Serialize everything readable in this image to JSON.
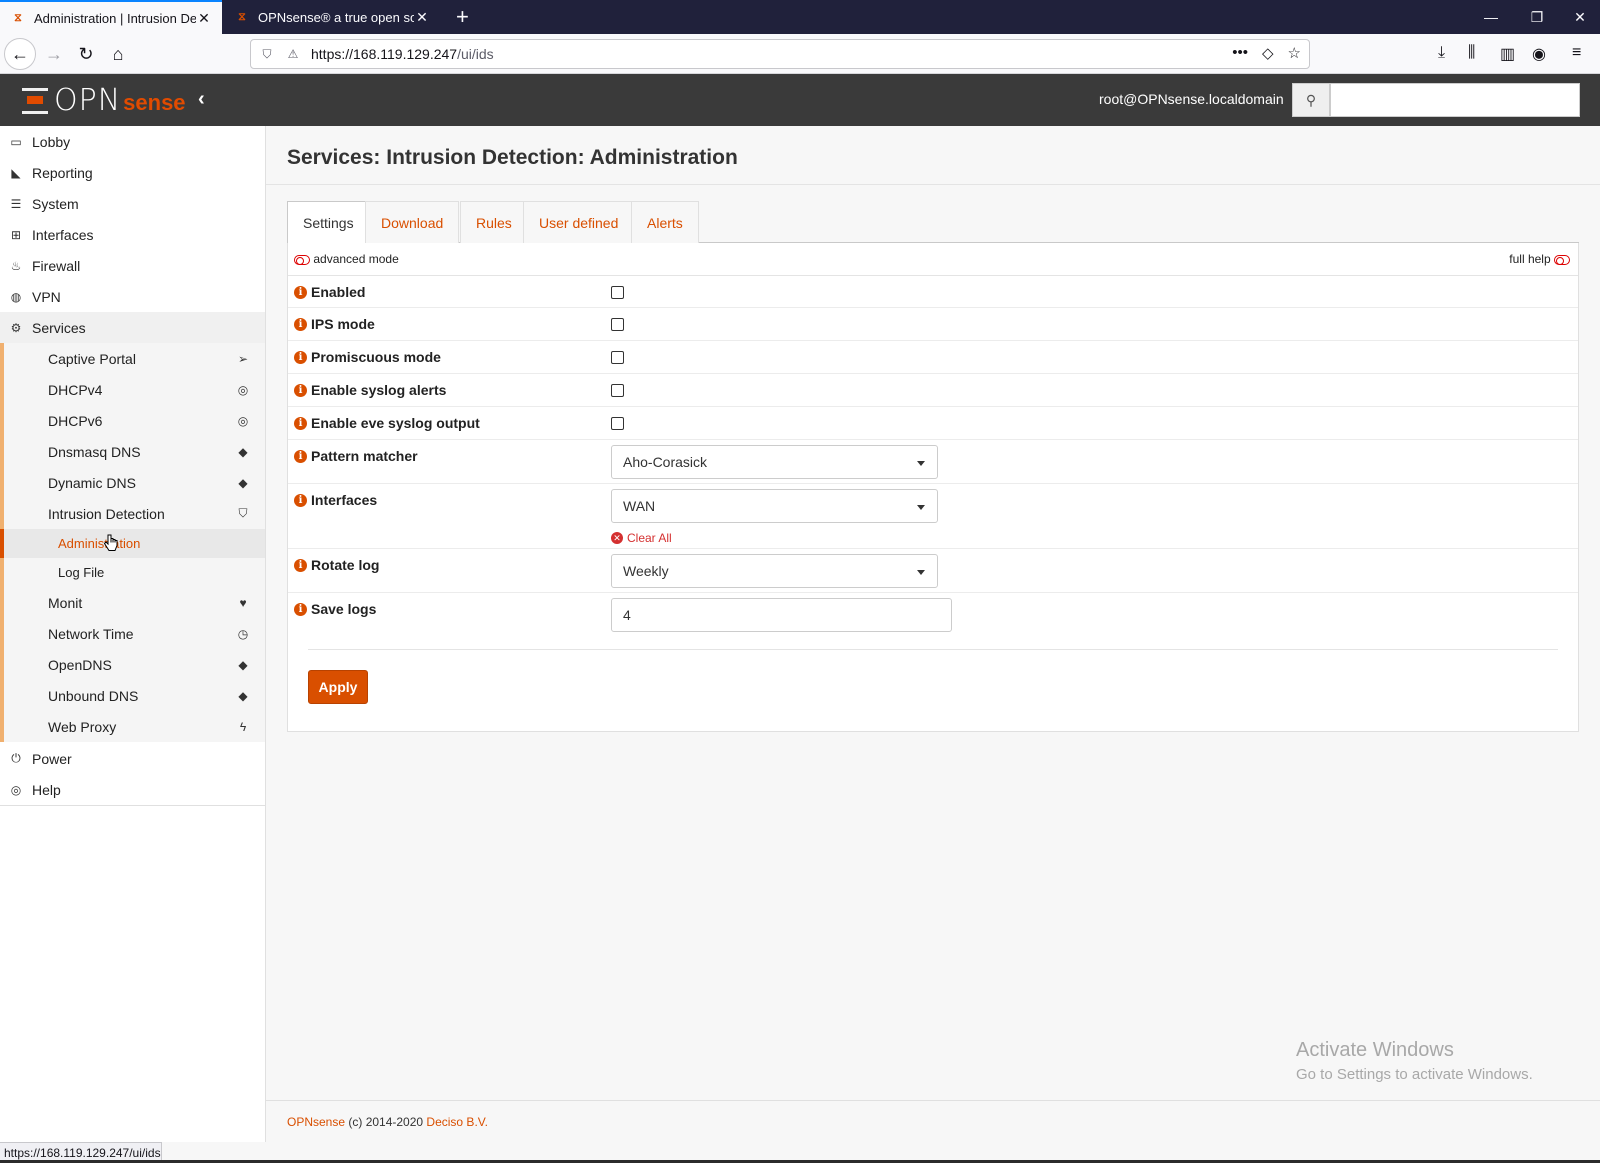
{
  "browser": {
    "tabs": [
      {
        "title": "Administration | Intrusion Dete"
      },
      {
        "title": "OPNsense® a true open sourc"
      }
    ],
    "url_host": "https://168.119.129.247",
    "url_path": "/ui/ids",
    "status_url": "https://168.119.129.247/ui/ids"
  },
  "header": {
    "logo_opn": "OPN",
    "logo_sense": "sense",
    "user": "root@OPNsense.localdomain",
    "search_placeholder": ""
  },
  "sidebar": {
    "items": [
      {
        "label": "Lobby",
        "icon": "laptop-icon"
      },
      {
        "label": "Reporting",
        "icon": "area-chart-icon"
      },
      {
        "label": "System",
        "icon": "server-icon"
      },
      {
        "label": "Interfaces",
        "icon": "sitemap-icon"
      },
      {
        "label": "Firewall",
        "icon": "fire-icon"
      },
      {
        "label": "VPN",
        "icon": "globe-icon"
      },
      {
        "label": "Services",
        "icon": "cog-icon"
      }
    ],
    "services": [
      {
        "label": "Captive Portal",
        "icon": "paper-plane-icon"
      },
      {
        "label": "DHCPv4",
        "icon": "bullseye-icon"
      },
      {
        "label": "DHCPv6",
        "icon": "bullseye-icon"
      },
      {
        "label": "Dnsmasq DNS",
        "icon": "tags-icon"
      },
      {
        "label": "Dynamic DNS",
        "icon": "tags-icon"
      },
      {
        "label": "Intrusion Detection",
        "icon": "shield-icon"
      },
      {
        "label": "Administration",
        "icon": ""
      },
      {
        "label": "Log File",
        "icon": ""
      },
      {
        "label": "Monit",
        "icon": "heartbeat-icon"
      },
      {
        "label": "Network Time",
        "icon": "clock-icon"
      },
      {
        "label": "OpenDNS",
        "icon": "tags-icon"
      },
      {
        "label": "Unbound DNS",
        "icon": "tags-icon"
      },
      {
        "label": "Web Proxy",
        "icon": "bolt-icon"
      }
    ],
    "bottom": [
      {
        "label": "Power",
        "icon": "plug-icon"
      },
      {
        "label": "Help",
        "icon": "life-ring-icon"
      }
    ]
  },
  "page": {
    "title": "Services: Intrusion Detection: Administration",
    "tabs": [
      "Settings",
      "Download",
      "Rules",
      "User defined",
      "Alerts"
    ],
    "advanced_mode": "advanced mode",
    "full_help": "full help",
    "fields": {
      "enabled": "Enabled",
      "ips_mode": "IPS mode",
      "promiscuous": "Promiscuous mode",
      "syslog_alerts": "Enable syslog alerts",
      "eve_syslog": "Enable eve syslog output",
      "pattern_matcher": "Pattern matcher",
      "pattern_matcher_value": "Aho-Corasick",
      "interfaces": "Interfaces",
      "interfaces_value": "WAN",
      "clear_all": "Clear All",
      "rotate_log": "Rotate log",
      "rotate_log_value": "Weekly",
      "save_logs": "Save logs",
      "save_logs_value": "4"
    },
    "apply": "Apply"
  },
  "watermark": {
    "line1": "Activate Windows",
    "line2": "Go to Settings to activate Windows."
  },
  "footer": {
    "brand": "OPNsense",
    "copy": " (c) 2014-2020 ",
    "company": "Deciso B.V."
  }
}
